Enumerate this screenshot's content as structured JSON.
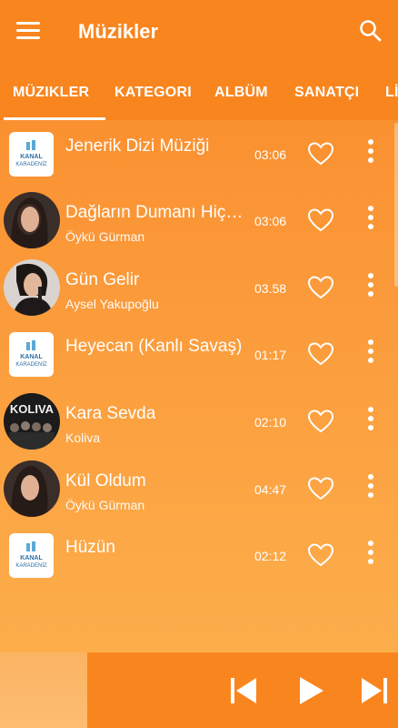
{
  "header": {
    "title": "Müzikler"
  },
  "tabs": [
    {
      "label": "MÜZIKLER",
      "active": true
    },
    {
      "label": "KATEGORI"
    },
    {
      "label": "ALBÜM"
    },
    {
      "label": "SANATÇI"
    },
    {
      "label": "Lİ"
    }
  ],
  "songs": [
    {
      "title": "Jenerik Dizi Müziği",
      "artist": "",
      "duration": "03:06",
      "thumb": "kanal-logo"
    },
    {
      "title": "Dağların Dumanı Hiç…",
      "artist": "Öykü Gürman",
      "duration": "03:06",
      "thumb": "artist-photo"
    },
    {
      "title": "Gün Gelir",
      "artist": "Aysel Yakupoğlu",
      "duration": "03.58",
      "thumb": "artist-photo"
    },
    {
      "title": "Heyecan (Kanlı Savaş)",
      "artist": "",
      "duration": "01:17",
      "thumb": "kanal-logo"
    },
    {
      "title": "Kara Sevda",
      "artist": "Koliva",
      "duration": "02:10",
      "thumb": "band-photo"
    },
    {
      "title": "Kül Oldum",
      "artist": "Öykü Gürman",
      "duration": "04:47",
      "thumb": "artist-photo"
    },
    {
      "title": "Hüzün",
      "artist": "",
      "duration": "02:12",
      "thumb": "kanal-logo"
    }
  ],
  "logo": {
    "text": "KANAL KARADENİZ"
  },
  "band_logo": {
    "text": "KOLIVA"
  },
  "colors": {
    "accent": "#f9851e",
    "background_top": "#fa8a2a",
    "background_bottom": "#fdb24f"
  },
  "icons": {
    "menu": "menu-icon",
    "search": "search-icon",
    "heart": "heart-outline-icon",
    "more": "more-vertical-icon",
    "previous": "skip-previous-icon",
    "play": "play-icon",
    "next": "skip-next-icon"
  }
}
